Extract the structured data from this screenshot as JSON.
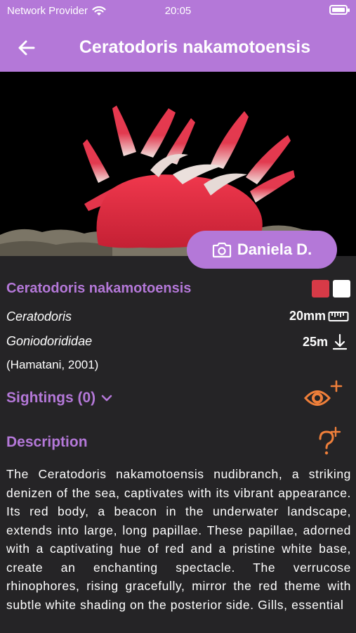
{
  "status_bar": {
    "carrier": "Network Provider",
    "time": "20:05"
  },
  "header": {
    "title": "Ceratodoris nakamotoensis",
    "back_icon": "arrow-left-icon"
  },
  "photo": {
    "photographer": "Daniela D.",
    "camera_icon": "camera-icon"
  },
  "species": {
    "name": "Ceratodoris nakamotoensis",
    "genus": "Ceratodoris",
    "family": "Goniodorididae",
    "authority": "(Hamatani, 2001)",
    "size": "20mm",
    "depth": "25m",
    "colors": [
      "#d73a47",
      "#ffffff"
    ]
  },
  "sightings": {
    "label": "Sightings (0)"
  },
  "description": {
    "heading": "Description",
    "text": "The Ceratodoris nakamotoensis nudibranch, a striking denizen of the sea, captivates with its vibrant appearance. Its red body, a beacon in the underwater landscape, extends into large, long papillae. These papillae, adorned with a captivating hue of red and a pristine white base, create an enchanting spectacle. The verrucose rhinophores, rising gracefully, mirror the red theme with subtle white shading on the posterior side. Gills, essential"
  },
  "colors": {
    "accent": "#b478d8",
    "background": "#252426",
    "icon_orange": "#ef7f3a"
  }
}
